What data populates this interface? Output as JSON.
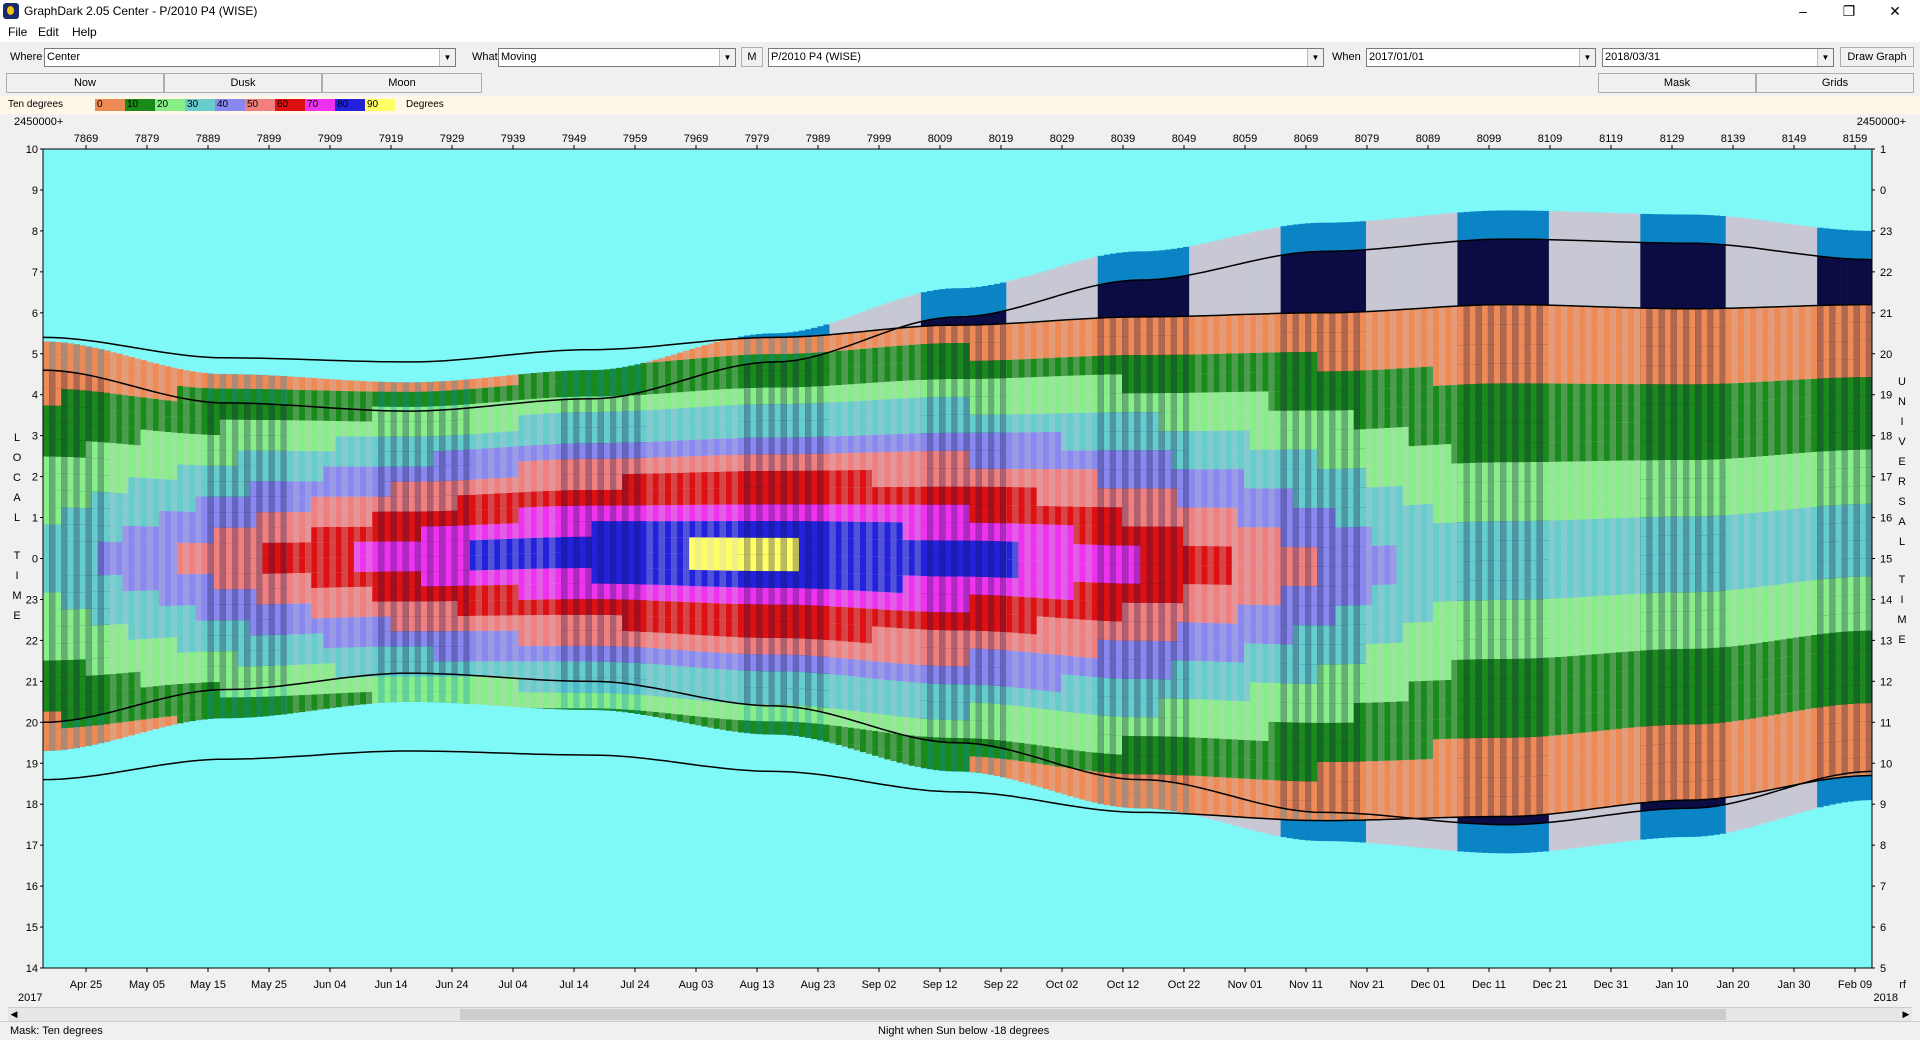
{
  "window": {
    "title": "GraphDark 2.05  Center  -  P/2010 P4 (WISE)"
  },
  "menu": [
    "File",
    "Edit",
    "Help"
  ],
  "toolbar": {
    "where_label": "Where",
    "where_value": "Center",
    "what_label": "What",
    "what_value": "Moving",
    "m_button": "M",
    "object_value": "P/2010 P4 (WISE)",
    "when_label": "When",
    "start_date": "2017/01/01",
    "end_date": "2018/03/31",
    "draw_button": "Draw Graph"
  },
  "buttons": {
    "now": "Now",
    "dusk": "Dusk",
    "moon": "Moon",
    "mask": "Mask",
    "grids": "Grids"
  },
  "legend": {
    "title": "Ten degrees",
    "units": "Degrees",
    "steps": [
      {
        "label": "0",
        "color": "#ee8a55"
      },
      {
        "label": "10",
        "color": "#1a8a1a"
      },
      {
        "label": "20",
        "color": "#88ee88"
      },
      {
        "label": "30",
        "color": "#66cccc"
      },
      {
        "label": "40",
        "color": "#8888ee"
      },
      {
        "label": "50",
        "color": "#f08080"
      },
      {
        "label": "60",
        "color": "#dd1111"
      },
      {
        "label": "70",
        "color": "#ee33ee"
      },
      {
        "label": "80",
        "color": "#2222dd"
      },
      {
        "label": "90",
        "color": "#ffff66"
      }
    ]
  },
  "colors": {
    "sky": "#7ff8f8",
    "night": "#0c0c44",
    "twilight": "#0a84c4",
    "moonlit": "#c8c8d4"
  },
  "chart_data": {
    "type": "area",
    "top_axis_prefix_left": "2450000+",
    "top_axis_prefix_right": "2450000+",
    "jd_ticks": [
      "7869",
      "7879",
      "7889",
      "7899",
      "7909",
      "7919",
      "7929",
      "7939",
      "7949",
      "7959",
      "7969",
      "7979",
      "7989",
      "7999",
      "8009",
      "8019",
      "8029",
      "8039",
      "8049",
      "8059",
      "8069",
      "8079",
      "8089",
      "8099",
      "8109",
      "8119",
      "8129",
      "8139",
      "8149",
      "8159"
    ],
    "date_ticks": [
      "Apr 25",
      "May 05",
      "May 15",
      "May 25",
      "Jun 04",
      "Jun 14",
      "Jun 24",
      "Jul 04",
      "Jul 14",
      "Jul 24",
      "Aug 03",
      "Aug 13",
      "Aug 23",
      "Sep 02",
      "Sep 12",
      "Sep 22",
      "Oct 02",
      "Oct 12",
      "Oct 22",
      "Nov 01",
      "Nov 11",
      "Nov 21",
      "Dec 01",
      "Dec 11",
      "Dec 21",
      "Dec 31",
      "Jan 10",
      "Jan 20",
      "Jan 30",
      "Feb 09"
    ],
    "year_left": "2017",
    "year_right": "2018",
    "right_corner": "rf",
    "left_ticks": [
      "10",
      "9",
      "8",
      "7",
      "6",
      "5",
      "4",
      "3",
      "2",
      "1",
      "0",
      "23",
      "22",
      "21",
      "20",
      "19",
      "18",
      "17",
      "16",
      "15",
      "14"
    ],
    "right_ticks": [
      "1",
      "0",
      "23",
      "22",
      "21",
      "20",
      "19",
      "18",
      "17",
      "16",
      "15",
      "14",
      "13",
      "12",
      "11",
      "10",
      "9",
      "8",
      "7",
      "6",
      "5"
    ],
    "left_axis_label": "LOCAL TIME",
    "right_axis_label": "UNIVERSAL TIME",
    "ylim": [
      14,
      34
    ],
    "dusk_hours": [
      20.0,
      20.8,
      21.2,
      21.0,
      20.4,
      19.5,
      18.6,
      17.8,
      17.5,
      17.9,
      18.8
    ],
    "dawn_hours": [
      28.6,
      27.8,
      27.6,
      27.9,
      28.8,
      29.9,
      30.8,
      31.5,
      31.8,
      31.7,
      31.3
    ],
    "object_rise_hours": [
      29.4,
      28.9,
      28.8,
      29.1,
      29.4,
      29.7,
      29.9,
      30.0,
      30.2,
      30.1,
      30.2
    ],
    "object_set_hours": [
      18.6,
      19.1,
      19.3,
      19.2,
      18.8,
      18.3,
      17.8,
      17.6,
      17.7,
      18.1,
      18.7
    ]
  },
  "status": {
    "mask": "Mask:  Ten degrees",
    "night_rule": "Night when Sun below -18 degrees"
  }
}
